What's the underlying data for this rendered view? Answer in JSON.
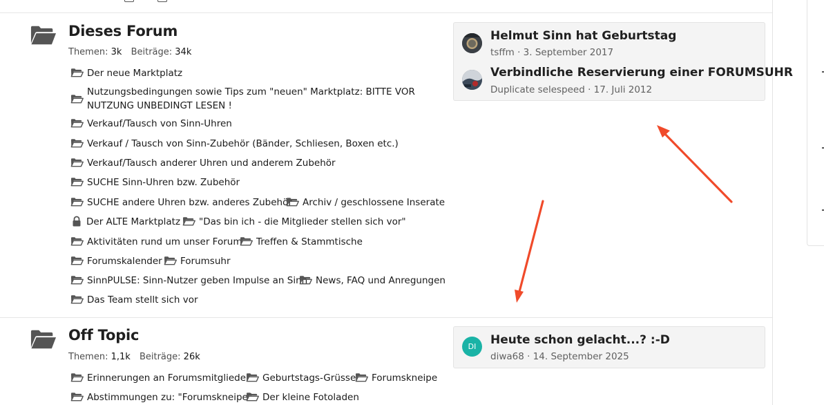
{
  "colors": {
    "accent_arrow": "#f04a2a",
    "avatar_di": "#1ab3a6",
    "text_muted": "#606060"
  },
  "nodes": [
    {
      "title": "Dieses Forum",
      "stats_threads_label": "Themen:",
      "stats_threads": "3k",
      "stats_posts_label": "Beiträge:",
      "stats_posts": "34k",
      "subforums": [
        "Der neue Marktplatz",
        "Nutzungsbedingungen sowie Tips zum \"neuen\" Marktplatz: BITTE VOR NUTZUNG UNBEDINGT LESEN !",
        "Verkauf/Tausch von Sinn-Uhren",
        "Verkauf / Tausch von Sinn-Zubehör (Bänder, Schliesen, Boxen etc.)",
        "Verkauf/Tausch anderer Uhren und anderem Zubehör",
        "SUCHE Sinn-Uhren bzw. Zubehör",
        "SUCHE andere Uhren bzw. anderes Zubehör",
        "Archiv / geschlossene Inserate",
        "Der ALTE Marktplatz",
        "\"Das bin ich - die Mitglieder stellen sich vor\"",
        "Aktivitäten rund um unser Forum",
        "Treffen & Stammtische",
        "Forumskalender",
        "Forumsuhr",
        "SinnPULSE: Sinn-Nutzer geben Impulse an Sinn",
        "News, FAQ und Anregungen",
        "Das Team stellt sich vor"
      ],
      "latest": [
        {
          "title": "Helmut Sinn hat Geburtstag",
          "meta": "tsffm · 3. September 2017",
          "avatar_icon": "user-photo-icon"
        },
        {
          "title": "Verbindliche Reservierung einer FORUMSUHR",
          "meta": "Duplicate selespeed · 17. Juli 2012",
          "avatar_icon": "user-photo-icon"
        }
      ]
    },
    {
      "title": "Off Topic",
      "stats_threads_label": "Themen:",
      "stats_threads": "1,1k",
      "stats_posts_label": "Beiträge:",
      "stats_posts": "26k",
      "subforums": [
        "Erinnerungen an Forumsmitglieder",
        "Geburtstags-Grüsse",
        "Forumskneipe",
        "Abstimmungen zu: \"Forumskneipe\"",
        "Der kleine Fotoladen"
      ],
      "latest": [
        {
          "title": "Heute schon gelacht...? :-D",
          "meta": "diwa68 · 14. September 2025",
          "avatar_initials": "DI"
        }
      ]
    }
  ]
}
